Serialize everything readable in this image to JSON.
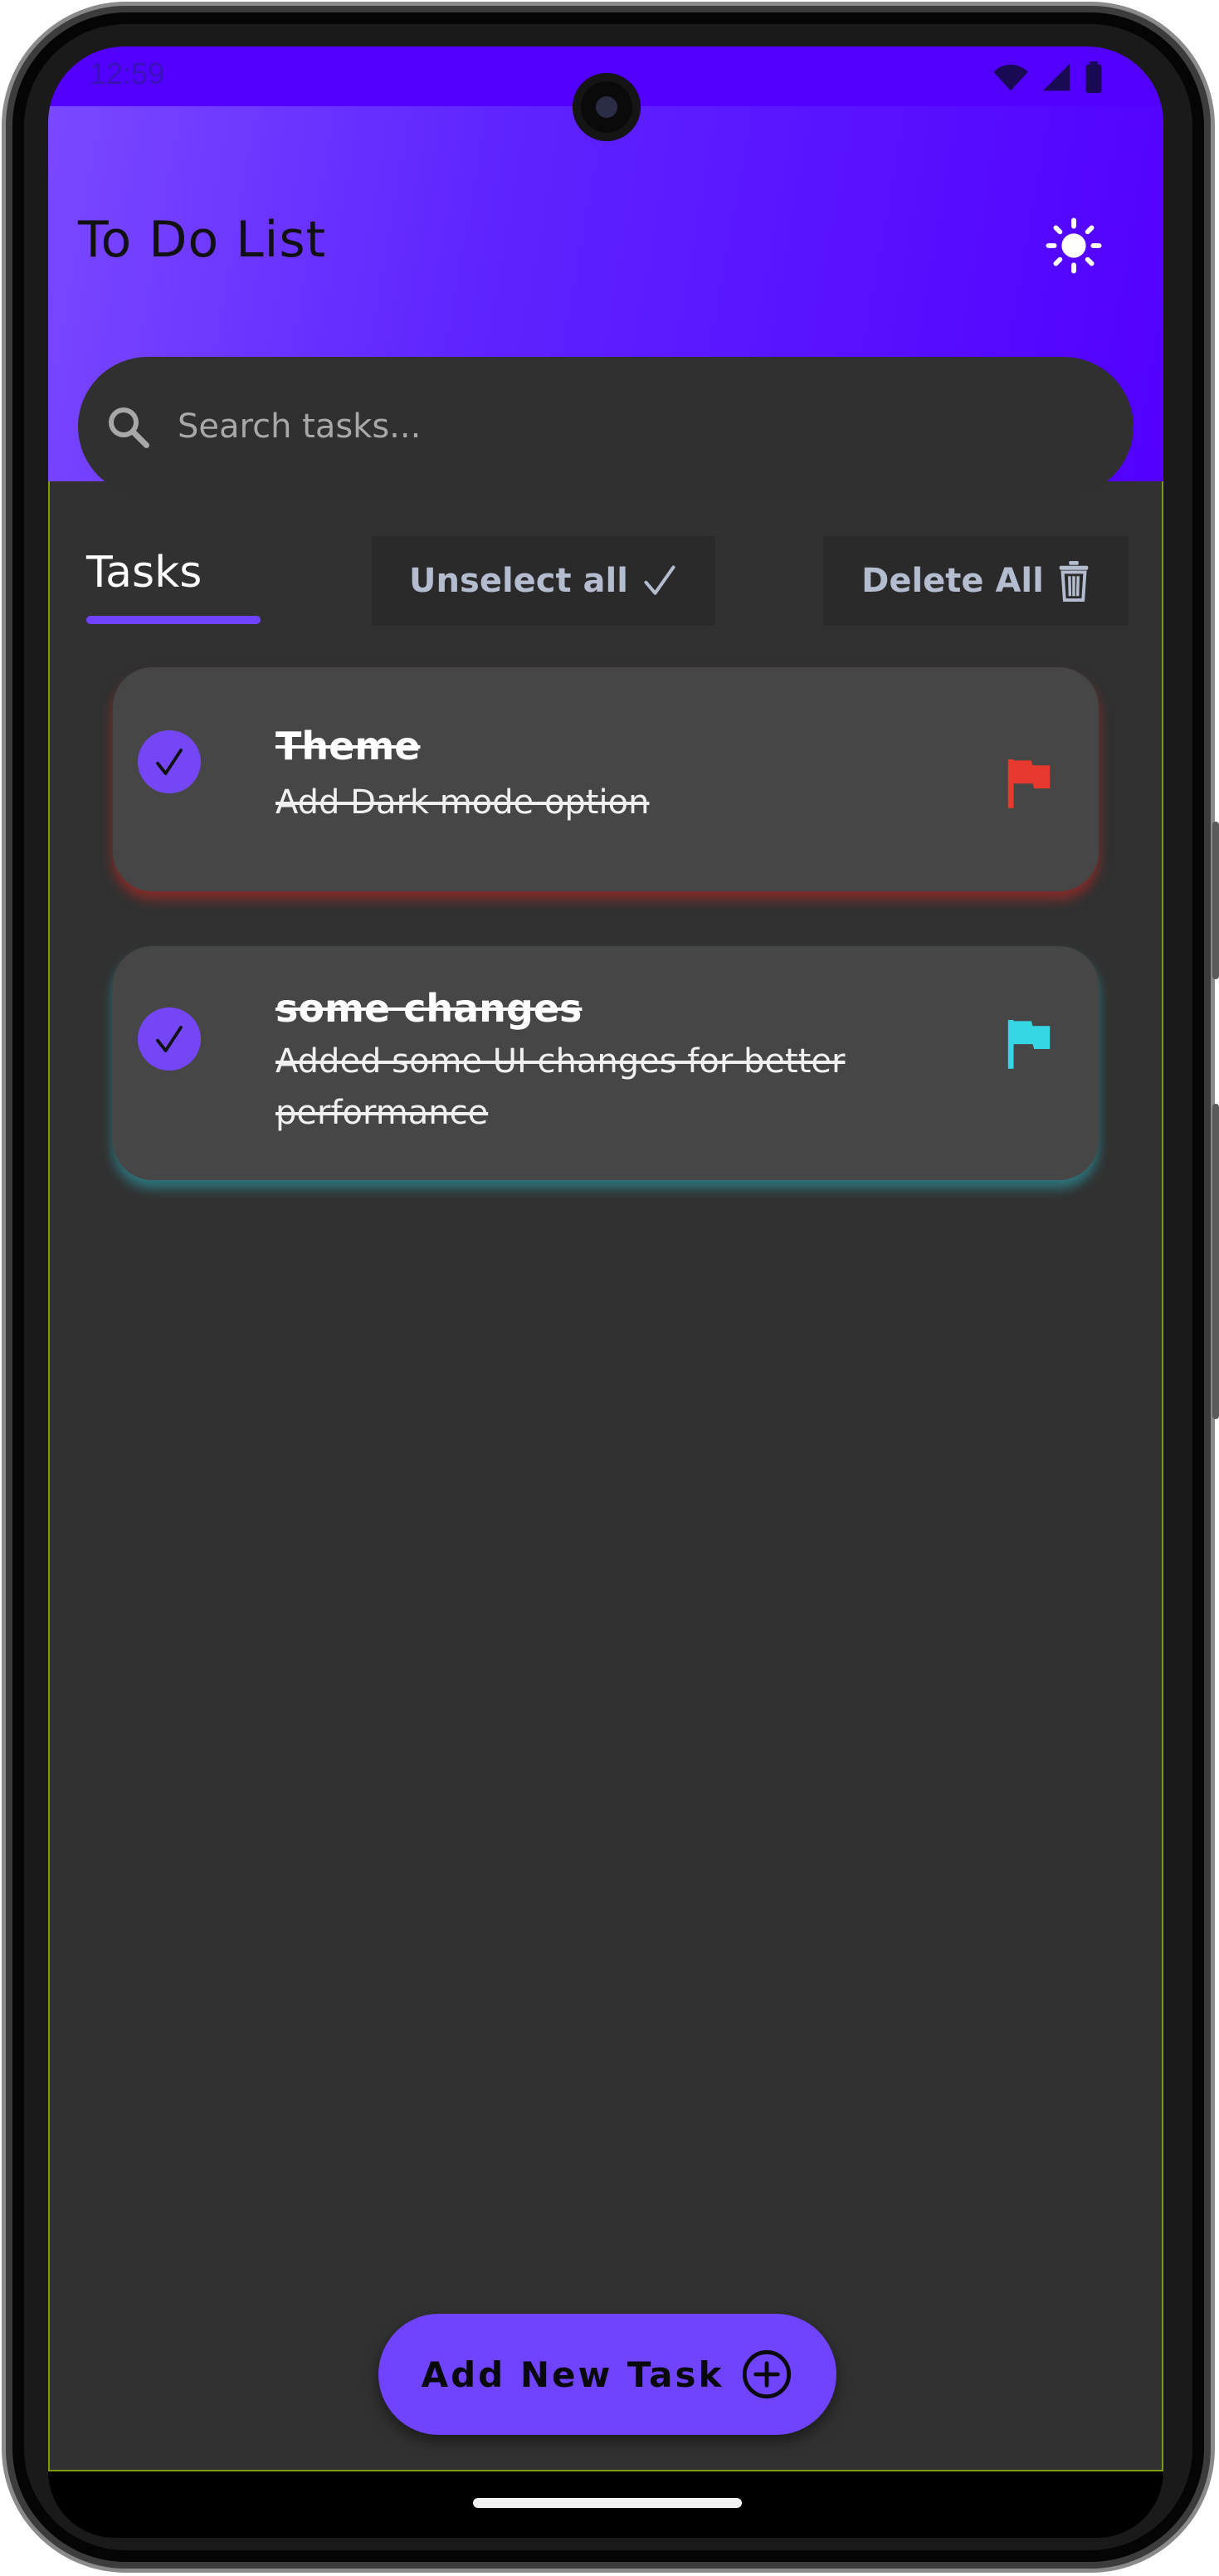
{
  "status_bar": {
    "time": "12:59"
  },
  "header": {
    "title": "To Do List",
    "search": {
      "placeholder": "Search tasks...",
      "value": ""
    }
  },
  "toolbar": {
    "tab_label": "Tasks",
    "unselect_label": "Unselect all",
    "delete_label": "Delete All"
  },
  "tasks": [
    {
      "title": "Theme",
      "description": "Add Dark mode option",
      "completed": true,
      "flag_color": "#e8392f"
    },
    {
      "title": "some changes",
      "description": "Added some UI changes for better performance",
      "completed": true,
      "flag_color": "#35d6e6"
    }
  ],
  "fab": {
    "label": "Add New Task"
  },
  "colors": {
    "accent": "#7044ff",
    "header_gradient_start": "#7a48ff",
    "header_gradient_end": "#5200ff",
    "background": "#313131",
    "card": "#464646"
  },
  "icons": {
    "theme_toggle": "sun-icon",
    "search": "search-icon",
    "unselect": "checkmark-icon",
    "delete": "trash-icon",
    "task_check": "checkmark-icon",
    "priority": "flag-icon",
    "fab": "plus-circle-icon"
  }
}
